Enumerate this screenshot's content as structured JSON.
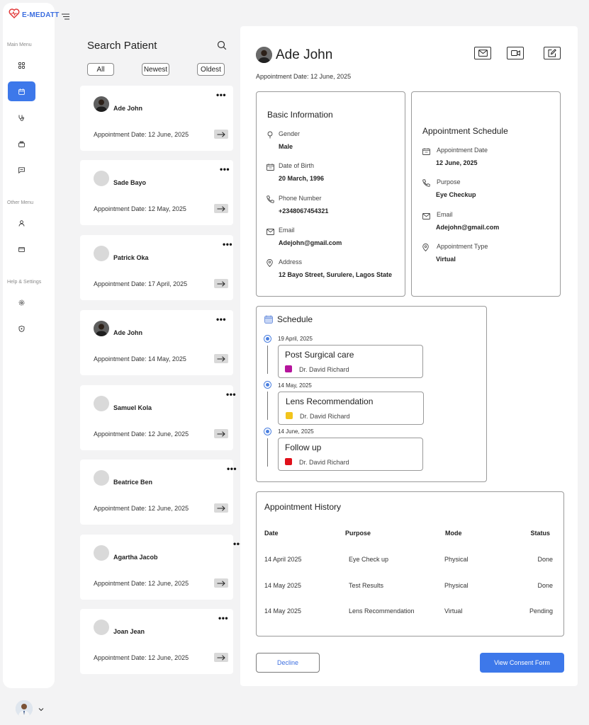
{
  "app": {
    "name": "E-MEDATT",
    "brand_color": "#3d6fe0",
    "accent_color": "#3d78ea"
  },
  "sidebar": {
    "sections": [
      {
        "label": "Main Menu",
        "items": [
          {
            "icon": "dashboard-icon"
          },
          {
            "icon": "calendar-icon",
            "active": true
          },
          {
            "icon": "stethoscope-icon"
          },
          {
            "icon": "inbox-icon"
          },
          {
            "icon": "chat-icon"
          }
        ]
      },
      {
        "label": "Other Menu",
        "items": [
          {
            "icon": "user-icon"
          },
          {
            "icon": "mail-icon"
          }
        ]
      },
      {
        "label": "Help & Settings",
        "items": [
          {
            "icon": "gear-icon"
          },
          {
            "icon": "shield-icon"
          }
        ]
      }
    ]
  },
  "patients_panel": {
    "title": "Search Patient",
    "filters": [
      "All",
      "Newest",
      "Oldest"
    ],
    "patients": [
      {
        "name": "Ade John",
        "date": "Appointment Date: 12 June, 2025",
        "has_photo": true
      },
      {
        "name": "Sade Bayo",
        "date": "Appointment Date: 12 May, 2025",
        "has_photo": false
      },
      {
        "name": "Patrick Oka",
        "date": "Appointment Date: 17 April, 2025",
        "has_photo": false
      },
      {
        "name": "Ade John",
        "date": "Appointment Date: 14 May, 2025",
        "has_photo": true
      },
      {
        "name": "Samuel Kola",
        "date": "Appointment Date: 12 June, 2025",
        "has_photo": false
      },
      {
        "name": "Beatrice Ben",
        "date": "Appointment Date: 12 June, 2025",
        "has_photo": false
      },
      {
        "name": "Agartha Jacob",
        "date": "Appointment Date: 12 June, 2025",
        "has_photo": false
      },
      {
        "name": "Joan Jean",
        "date": "Appointment Date: 12 June, 2025",
        "has_photo": false
      }
    ]
  },
  "detail": {
    "name": "Ade John",
    "appointment_date": "Appointment Date: 12 June, 2025",
    "basic_info": {
      "title": "Basic Information",
      "fields": [
        {
          "label": "Gender",
          "value": "Male",
          "icon": "gender-icon"
        },
        {
          "label": "Date of Birth",
          "value": "20 March, 1996",
          "icon": "calendar-icon"
        },
        {
          "label": "Phone Number",
          "value": "+2348067454321",
          "icon": "phone-icon"
        },
        {
          "label": "Email",
          "value": "Adejohn@gmail.com",
          "icon": "mail-icon"
        },
        {
          "label": "Address",
          "value": "12 Bayo Street, Surulere, Lagos State",
          "icon": "location-icon"
        }
      ]
    },
    "appointment_schedule": {
      "title": "Appointment Schedule",
      "fields": [
        {
          "label": "Appointment Date",
          "value": "12 June, 2025",
          "icon": "calendar-icon"
        },
        {
          "label": "Purpose",
          "value": "Eye Checkup",
          "icon": "phone-icon"
        },
        {
          "label": "Email",
          "value": "Adejohn@gmail.com",
          "icon": "mail-icon"
        },
        {
          "label": "Appointment Type",
          "value": "Virtual",
          "icon": "location-icon"
        }
      ]
    },
    "schedule": {
      "title": "Schedule",
      "items": [
        {
          "date": "19 April, 2025",
          "title": "Post Surgical care",
          "doctor": "Dr. David Richard",
          "color": "#b5149c"
        },
        {
          "date": "14 May, 2025",
          "title": "Lens Recommendation",
          "doctor": "Dr. David Richard",
          "color": "#f2c41c"
        },
        {
          "date": "14 June, 2025",
          "title": "Follow up",
          "doctor": "Dr. David Richard",
          "color": "#e0101a"
        }
      ]
    },
    "history": {
      "title": "Appointment History",
      "columns": [
        "Date",
        "Purpose",
        "Mode",
        "Status"
      ],
      "rows": [
        [
          "14 April 2025",
          "Eye Check up",
          "Physical",
          "Done"
        ],
        [
          "14 May 2025",
          "Test Results",
          "Physical",
          "Done"
        ],
        [
          "14 May 2025",
          "Lens Recommendation",
          "Virtual",
          "Pending"
        ]
      ]
    },
    "buttons": {
      "decline": "Decline",
      "consent": "View Consent Form"
    }
  }
}
